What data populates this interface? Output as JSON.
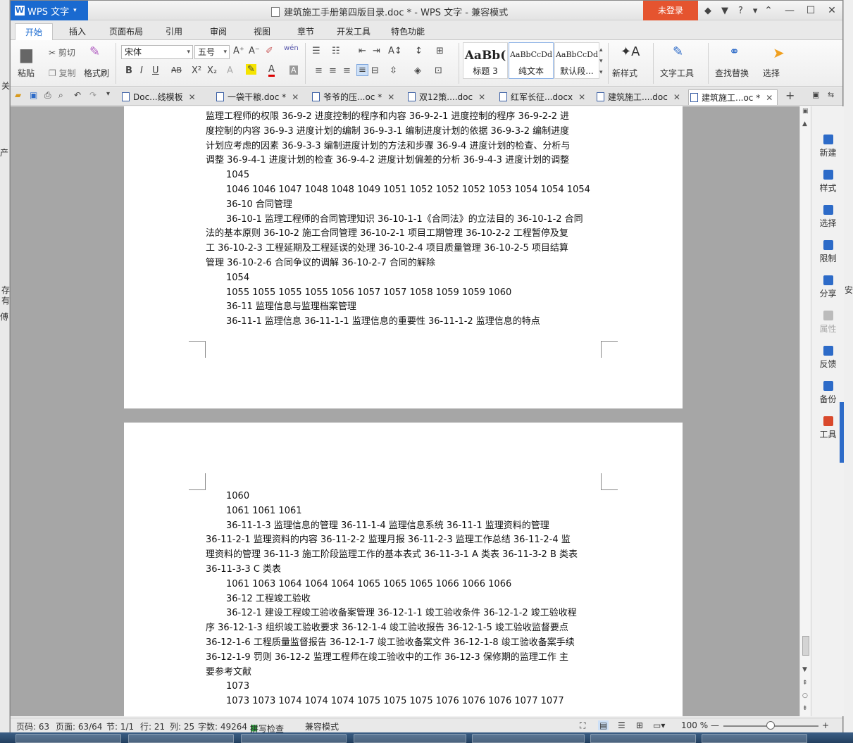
{
  "background_app": {
    "left_fragments": [
      "关",
      "产",
      "存",
      "有",
      "傅"
    ],
    "right_fragments": [
      "安"
    ]
  },
  "titlebar": {
    "app_name": "WPS 文字",
    "document_title": "建筑施工手册第四版目录.doc * - WPS 文字 - 兼容模式",
    "login_label": "未登录",
    "help_label": "?"
  },
  "menu_tabs": [
    "开始",
    "插入",
    "页面布局",
    "引用",
    "审阅",
    "视图",
    "章节",
    "开发工具",
    "特色功能"
  ],
  "ribbon": {
    "paste": "粘贴",
    "cut": "剪切",
    "copy": "复制",
    "format_painter": "格式刷",
    "font_name": "宋体",
    "font_size": "五号",
    "styles": [
      {
        "preview": "AaBb(",
        "caption": "标题 3"
      },
      {
        "preview": "AaBbCcDd",
        "caption": "纯文本"
      },
      {
        "preview": "AaBbCcDd",
        "caption": "默认段..."
      }
    ],
    "new_style": "新样式",
    "text_tools": "文字工具",
    "find_replace": "查找替换",
    "select": "选择"
  },
  "doc_tabs": [
    {
      "label": "Doc...线模板",
      "active": false
    },
    {
      "label": "一袋干粮.doc *",
      "active": false
    },
    {
      "label": "爷爷的压...oc *",
      "active": false
    },
    {
      "label": "双12策....doc",
      "active": false
    },
    {
      "label": "红军长征...docx",
      "active": false
    },
    {
      "label": "建筑施工....doc",
      "active": false
    },
    {
      "label": "建筑施工...oc *",
      "active": true
    }
  ],
  "page1_lines": [
    {
      "text": "监理工程师的权限 36-9-2 进度控制的程序和内容 36-9-2-1 进度控制的程序 36-9-2-2 进",
      "indent": false
    },
    {
      "text": "度控制的内容 36-9-3 进度计划的编制 36-9-3-1 编制进度计划的依据 36-9-3-2 编制进度",
      "indent": false
    },
    {
      "text": "计划应考虑的因素 36-9-3-3 编制进度计划的方法和步骤 36-9-4 进度计划的检查、分析与",
      "indent": false
    },
    {
      "text": "调整 36-9-4-1 进度计划的检查 36-9-4-2 进度计划偏差的分析 36-9-4-3 进度计划的调整",
      "indent": false
    },
    {
      "text": "1045",
      "indent": true
    },
    {
      "text": "1046 1046 1047 1048 1048 1049 1051 1052 1052 1052 1053 1054 1054 1054",
      "indent": true
    },
    {
      "text": "36-10 合同管理",
      "indent": true
    },
    {
      "text": "36-10-1 监理工程师的合同管理知识 36-10-1-1《合同法》的立法目的 36-10-1-2 合同",
      "indent": true
    },
    {
      "text": "法的基本原则 36-10-2 施工合同管理 36-10-2-1 项目工期管理 36-10-2-2 工程暂停及复",
      "indent": false
    },
    {
      "text": "工 36-10-2-3 工程延期及工程延误的处理 36-10-2-4 项目质量管理 36-10-2-5 项目结算",
      "indent": false
    },
    {
      "text": "管理 36-10-2-6 合同争议的调解 36-10-2-7 合同的解除",
      "indent": false
    },
    {
      "text": "1054",
      "indent": true
    },
    {
      "text": "1055 1055 1055 1055 1056 1057 1057 1058 1059 1059 1060",
      "indent": true
    },
    {
      "text": "36-11 监理信息与监理档案管理",
      "indent": true
    },
    {
      "text": "36-11-1 监理信息 36-11-1-1 监理信息的重要性 36-11-1-2 监理信息的特点",
      "indent": true
    }
  ],
  "page2_lines": [
    {
      "text": "1060",
      "indent": true
    },
    {
      "text": "1061 1061 1061",
      "indent": true
    },
    {
      "text": "36-11-1-3 监理信息的管理 36-11-1-4 监理信息系统 36-11-1 监理资料的管理",
      "indent": true
    },
    {
      "text": "36-11-2-1 监理资料的内容 36-11-2-2 监理月报 36-11-2-3 监理工作总结 36-11-2-4 监",
      "indent": false
    },
    {
      "text": "理资料的管理 36-11-3 施工阶段监理工作的基本表式 36-11-3-1 A 类表 36-11-3-2 B 类表",
      "indent": false
    },
    {
      "text": "36-11-3-3 C 类表",
      "indent": false
    },
    {
      "text": "1061 1063 1064 1064 1064 1065 1065 1065 1066 1066 1066",
      "indent": true
    },
    {
      "text": "36-12 工程竣工验收",
      "indent": true
    },
    {
      "text": "36-12-1 建设工程竣工验收备案管理 36-12-1-1 竣工验收条件 36-12-1-2 竣工验收程",
      "indent": true
    },
    {
      "text": "序 36-12-1-3 组织竣工验收要求 36-12-1-4 竣工验收报告 36-12-1-5 竣工验收监督要点",
      "indent": false
    },
    {
      "text": "36-12-1-6 工程质量监督报告 36-12-1-7 竣工验收备案文件 36-12-1-8 竣工验收备案手续",
      "indent": false
    },
    {
      "text": "36-12-1-9 罚则 36-12-2 监理工程师在竣工验收中的工作 36-12-3 保修期的监理工作 主",
      "indent": false
    },
    {
      "text": "要参考文献",
      "indent": false
    },
    {
      "text": "1073",
      "indent": true
    },
    {
      "text": "1073 1073 1074 1074 1074 1075 1075 1075 1076 1076 1076 1077 1077",
      "indent": true
    }
  ],
  "right_panel": [
    {
      "label": "新建",
      "enabled": true
    },
    {
      "label": "样式",
      "enabled": true
    },
    {
      "label": "选择",
      "enabled": true
    },
    {
      "label": "限制",
      "enabled": true
    },
    {
      "label": "分享",
      "enabled": true
    },
    {
      "label": "属性",
      "enabled": false
    },
    {
      "label": "反馈",
      "enabled": true
    },
    {
      "label": "备份",
      "enabled": true
    },
    {
      "label": "工具",
      "enabled": true
    }
  ],
  "status": {
    "page_num": "页码: 63",
    "pages": "页面: 63/64",
    "section": "节: 1/1",
    "row": "行: 21",
    "col": "列: 25",
    "word_count": "字数: 49264",
    "spell_check": "拼写检查",
    "compat_mode": "兼容模式",
    "zoom": "100 %"
  }
}
